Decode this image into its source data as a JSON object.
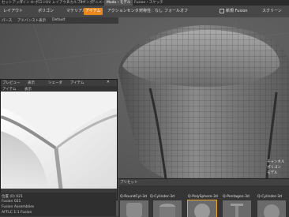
{
  "tabs": {
    "items": [
      "セットアップ",
      "ペイント",
      "トポロジ",
      "UV",
      "レイアウト",
      "スカルプト",
      "リギング",
      "アニメーション",
      "レンダリング",
      "Modo・モデル",
      "Fusion・スケッチ"
    ],
    "active_index": 9
  },
  "toolbar": {
    "left_label": "レイアウト",
    "item1": "ポリゴン",
    "item2": "マテリアル",
    "item3": "アイテム",
    "action": "アクションセンター",
    "symmetry": "対称性：なし",
    "falloff": "フォールオフ",
    "snap_label": "新規 Fusion",
    "right_label": "スクリーン"
  },
  "viewport": {
    "strip1": "パース",
    "strip2": "アドバンスト表示",
    "strip3": "Default"
  },
  "preview": {
    "tabs": [
      "プレビュー",
      "表示",
      "シェーダ",
      "アイテム"
    ],
    "subtabs": [
      "アイテム",
      "表示"
    ]
  },
  "info": [
    "位置 (0) 021",
    "Fusion 021",
    "Fusion Assemblies",
    "AFFLC 1:1 Fusion"
  ],
  "right_panel": [
    "チャンネル",
    "ポリゴン",
    "モデル",
    "リスト"
  ],
  "presets": {
    "header": "プリセット",
    "labels": [
      "Q-RoundCyl-3d",
      "Q-Cylinder-3d",
      "Q-Cylinder-3d",
      "Q-PolySphere-3d",
      "Q-Pentagon-3d",
      "Q-Cylinder-3d"
    ]
  },
  "colors": {
    "accent": "#e8871e",
    "mesh_dark": "#6c6c6c",
    "mesh_light": "#9a9a9a",
    "selected": "#e8a32a"
  }
}
